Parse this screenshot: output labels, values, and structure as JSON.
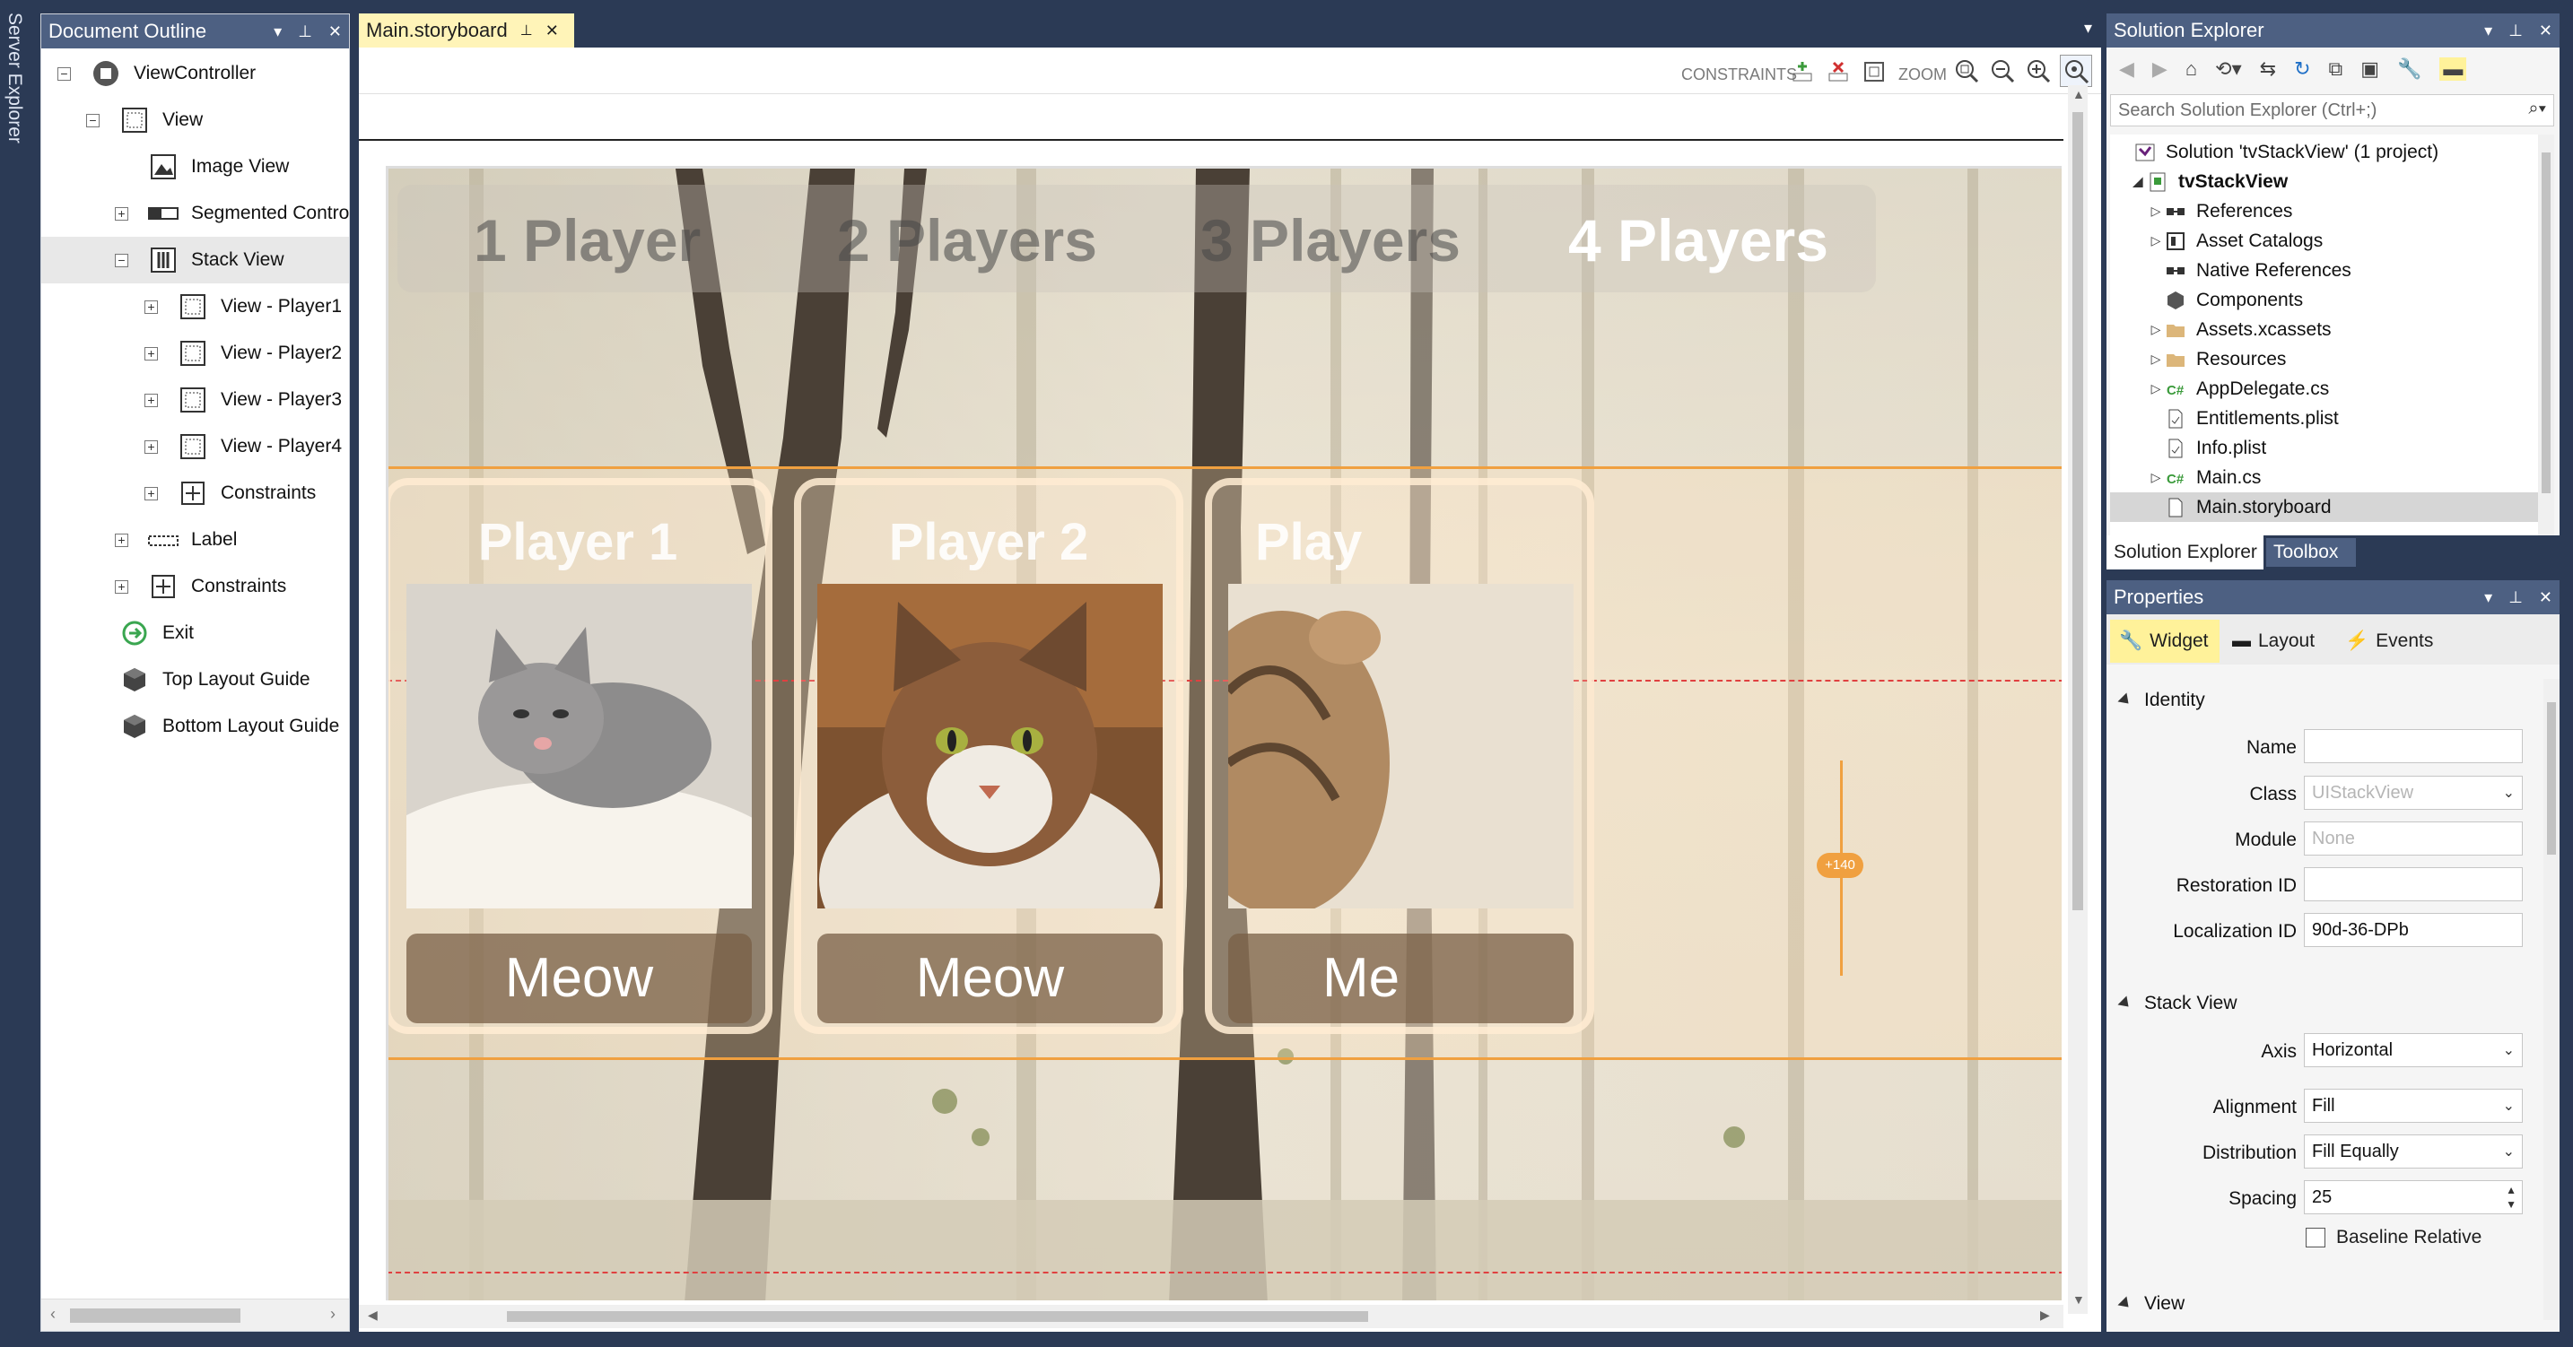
{
  "server_explorer": {
    "label": "Server Explorer"
  },
  "outline": {
    "title": "Document Outline",
    "items": [
      {
        "label": "ViewController",
        "icon": "viewcontroller-icon"
      },
      {
        "label": "View",
        "icon": "view-icon"
      },
      {
        "label": "Image View",
        "icon": "imageview-icon"
      },
      {
        "label": "Segmented Contro",
        "icon": "segmented-icon"
      },
      {
        "label": "Stack View",
        "icon": "stackview-icon"
      },
      {
        "label": "View - Player1",
        "icon": "view-icon"
      },
      {
        "label": "View - Player2",
        "icon": "view-icon"
      },
      {
        "label": "View - Player3",
        "icon": "view-icon"
      },
      {
        "label": "View - Player4",
        "icon": "view-icon"
      },
      {
        "label": "Constraints",
        "icon": "constraints-icon"
      },
      {
        "label": "Label",
        "icon": "label-icon"
      },
      {
        "label": "Constraints",
        "icon": "constraints-icon"
      },
      {
        "label": "Exit",
        "icon": "exit-icon"
      },
      {
        "label": "Top Layout Guide",
        "icon": "layout-guide-icon"
      },
      {
        "label": "Bottom Layout Guide",
        "icon": "layout-guide-icon"
      }
    ],
    "expand_collapsed": "+",
    "expand_open": "−"
  },
  "editor": {
    "tab_label": "Main.storyboard",
    "toolbar": {
      "constraints_label": "CONSTRAINTS",
      "zoom_label": "ZOOM"
    },
    "segments": [
      "1 Player",
      "2 Players",
      "3 Players",
      "4 Players"
    ],
    "cards": [
      {
        "name": "Player 1",
        "button": "Meow"
      },
      {
        "name": "Player 2",
        "button": "Meow"
      },
      {
        "name": "Play",
        "button": "Me"
      }
    ],
    "spacing_badge": "+140"
  },
  "solution_explorer": {
    "title": "Solution Explorer",
    "search_placeholder": "Search Solution Explorer (Ctrl+;)",
    "items": [
      {
        "label": "Solution 'tvStackView' (1 project)",
        "icon": "solution-icon"
      },
      {
        "label": "tvStackView",
        "icon": "project-icon"
      },
      {
        "label": "References",
        "icon": "references-icon"
      },
      {
        "label": "Asset Catalogs",
        "icon": "asset-catalog-icon"
      },
      {
        "label": "Native References",
        "icon": "references-icon"
      },
      {
        "label": "Components",
        "icon": "components-icon"
      },
      {
        "label": "Assets.xcassets",
        "icon": "folder-icon"
      },
      {
        "label": "Resources",
        "icon": "folder-icon"
      },
      {
        "label": "AppDelegate.cs",
        "icon": "csharp-icon"
      },
      {
        "label": "Entitlements.plist",
        "icon": "plist-icon"
      },
      {
        "label": "Info.plist",
        "icon": "plist-icon"
      },
      {
        "label": "Main.cs",
        "icon": "csharp-icon"
      },
      {
        "label": "Main.storyboard",
        "icon": "file-icon"
      }
    ],
    "bottom_tabs": [
      "Solution Explorer",
      "Toolbox"
    ]
  },
  "properties": {
    "title": "Properties",
    "tabs": [
      "Widget",
      "Layout",
      "Events"
    ],
    "identity_header": "Identity",
    "name_label": "Name",
    "name_value": "",
    "class_label": "Class",
    "class_value": "UIStackView",
    "module_label": "Module",
    "module_value": "None",
    "restoration_label": "Restoration ID",
    "restoration_value": "",
    "localization_label": "Localization ID",
    "localization_value": "90d-36-DPb",
    "stack_header": "Stack View",
    "axis_label": "Axis",
    "axis_value": "Horizontal",
    "alignment_label": "Alignment",
    "alignment_value": "Fill",
    "distribution_label": "Distribution",
    "distribution_value": "Fill Equally",
    "spacing_label": "Spacing",
    "spacing_value": "25",
    "baseline_label": "Baseline Relative",
    "view_header": "View"
  },
  "colors": {
    "title_bar": "#4d6082",
    "frame": "#2b3a55",
    "active_tab": "#fff4b8",
    "selection_orange": "#f0a040"
  }
}
